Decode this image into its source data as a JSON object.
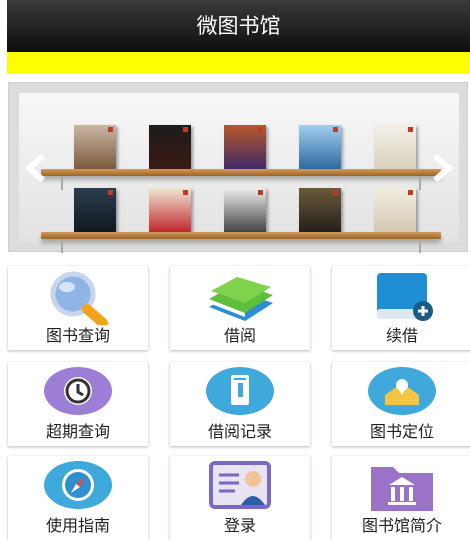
{
  "header": {
    "title": "微图书馆"
  },
  "menu": [
    {
      "label": "图书查询",
      "icon": "magnifier-icon"
    },
    {
      "label": "借阅",
      "icon": "books-icon"
    },
    {
      "label": "续借",
      "icon": "renew-book-icon"
    },
    {
      "label": "超期查询",
      "icon": "clock-icon"
    },
    {
      "label": "借阅记录",
      "icon": "record-icon"
    },
    {
      "label": "图书定位",
      "icon": "location-icon"
    },
    {
      "label": "使用指南",
      "icon": "compass-icon"
    },
    {
      "label": "登录",
      "icon": "user-card-icon"
    },
    {
      "label": "图书馆简介",
      "icon": "library-folder-icon"
    }
  ],
  "colors": {
    "header": "#1a1a1a",
    "accent_bar": "#ffff00",
    "shelf": "#c8894a"
  }
}
